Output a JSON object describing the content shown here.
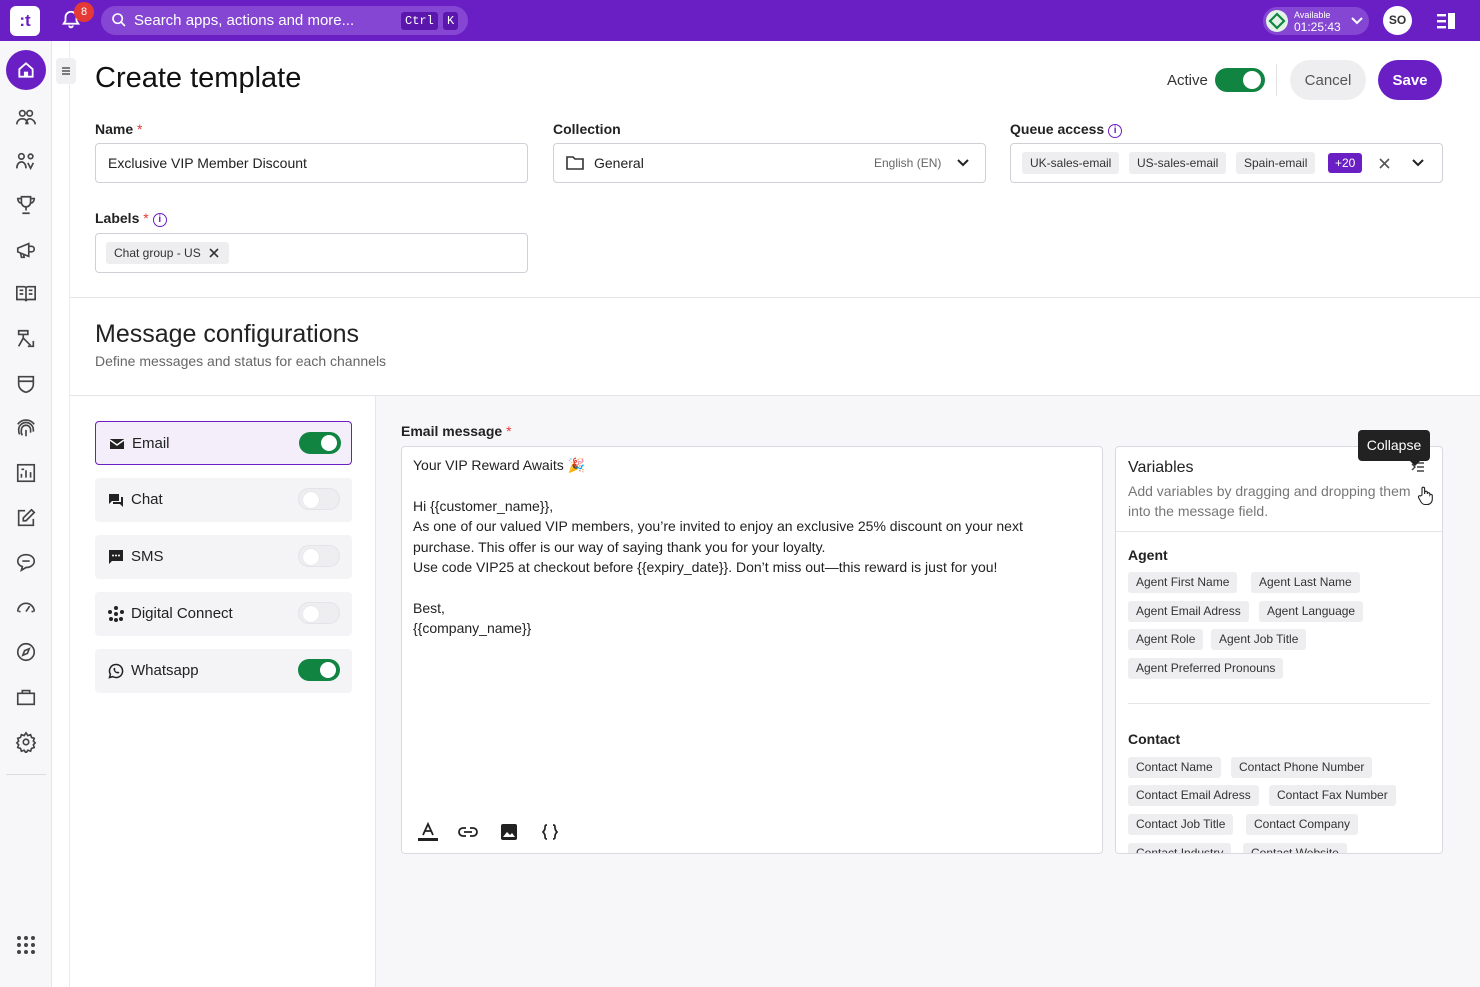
{
  "topbar": {
    "logo": ":t",
    "notifications_count": "8",
    "search_placeholder": "Search apps, actions and more...",
    "shortcut_ctrl": "Ctrl",
    "shortcut_key": "K",
    "status_label": "Available",
    "status_time": "01:25:43",
    "avatar_initials": "SO"
  },
  "header": {
    "title": "Create template",
    "active_label": "Active",
    "active_on": true,
    "cancel_label": "Cancel",
    "save_label": "Save"
  },
  "form": {
    "name_label": "Name",
    "name_value": "Exclusive VIP Member Discount",
    "collection_label": "Collection",
    "collection_value": "General",
    "collection_language": "English (EN)",
    "queue_label": "Queue access",
    "queues": [
      "UK-sales-email",
      "US-sales-email",
      "Spain-email"
    ],
    "queues_more": "+20",
    "labels_label": "Labels",
    "labels": [
      "Chat group - US"
    ]
  },
  "message_config": {
    "title": "Message configurations",
    "subtitle": "Define messages and status for each channels"
  },
  "channels": [
    {
      "label": "Email",
      "icon": "email-icon",
      "enabled": true,
      "selected": true
    },
    {
      "label": "Chat",
      "icon": "chat-icon",
      "enabled": false,
      "selected": false
    },
    {
      "label": "SMS",
      "icon": "sms-icon",
      "enabled": false,
      "selected": false
    },
    {
      "label": "Digital Connect",
      "icon": "digital-connect-icon",
      "enabled": false,
      "selected": false
    },
    {
      "label": "Whatsapp",
      "icon": "whatsapp-icon",
      "enabled": true,
      "selected": false
    }
  ],
  "editor": {
    "label": "Email message",
    "lines": [
      "Your VIP Reward Awaits 🎉",
      "",
      "Hi {{customer_name}},",
      "As one of our valued VIP members, you’re invited to enjoy an exclusive 25% discount on your next",
      "purchase. This offer is our way of saying thank you for your loyalty.",
      "Use code VIP25 at checkout before {{expiry_date}}. Don’t miss out—this reward is just for you!",
      "",
      "Best,",
      " {{company_name}}"
    ]
  },
  "variables": {
    "title": "Variables",
    "subtitle": "Add variables by dragging and dropping them into the message field.",
    "tooltip": "Collapse",
    "agent_title": "Agent",
    "agent": [
      "Agent  First Name",
      "Agent Last Name",
      "Agent Email Adress",
      "Agent Language",
      "Agent Role",
      "Agent Job Title",
      "Agent Preferred Pronouns"
    ],
    "contact_title": "Contact",
    "contact": [
      "Contact Name",
      "Contact Phone Number",
      "Contact Email Adress",
      "Contact Fax Number",
      "Contact Job Title",
      "Contact Company",
      "Contact Industry",
      "Contact Website"
    ]
  },
  "colors": {
    "brand": "#6a1fc4",
    "toggle_on": "#118442",
    "required": "#e53935"
  }
}
